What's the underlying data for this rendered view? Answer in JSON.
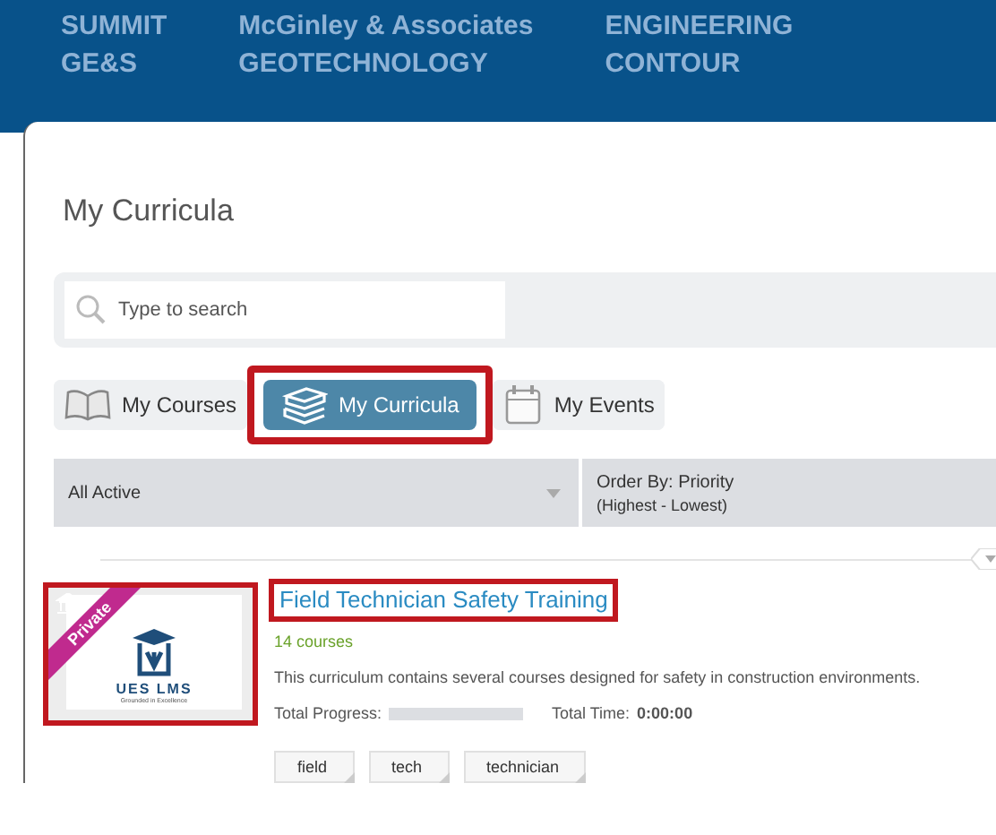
{
  "banner": {
    "logos": [
      {
        "text": "SUMMIT"
      },
      {
        "text": "McGinley & Associates"
      },
      {
        "text": "ENGINEERING"
      },
      {
        "text": "GE&S"
      },
      {
        "text": "GEOTECHNOLOGY"
      },
      {
        "text": "CONTOUR"
      }
    ]
  },
  "page_title": "My Curricula",
  "search": {
    "placeholder": "Type to search"
  },
  "tabs": [
    {
      "label": "My Courses",
      "selected": false,
      "highlighted": false
    },
    {
      "label": "My Curricula",
      "selected": true,
      "highlighted": true
    },
    {
      "label": "My Events",
      "selected": false,
      "highlighted": false
    }
  ],
  "filters": {
    "status": "All Active",
    "order_by": "Order By: Priority",
    "order_detail": "(Highest - Lowest)"
  },
  "curricula": [
    {
      "ribbon": "Private",
      "thumbnail_title": "UES LMS",
      "thumbnail_subtitle": "Grounded in Excellence",
      "thumbnail_highlighted": true,
      "title": "Field Technician Safety Training",
      "title_highlighted": true,
      "course_count": "14 courses",
      "description": "This curriculum contains several courses designed for safety in construction environments.",
      "progress_label": "Total Progress:",
      "level": 0,
      "time_label": "Total Time:",
      "time": "0:00:00",
      "tags": [
        "field",
        "tech",
        "technician"
      ]
    }
  ]
}
